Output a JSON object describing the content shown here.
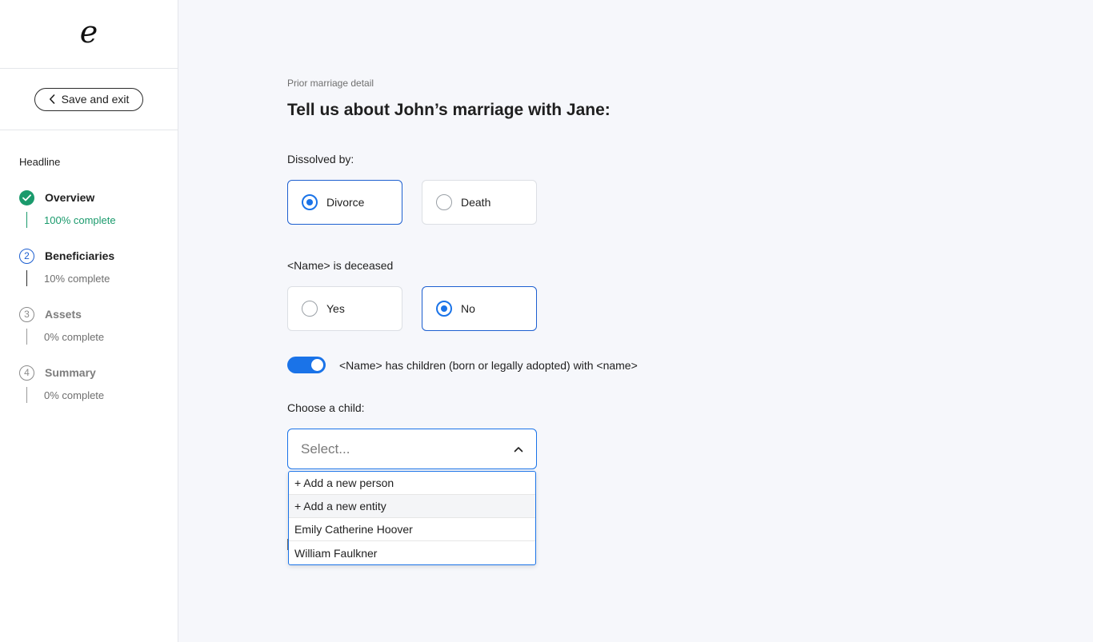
{
  "sidebar": {
    "logo_text": "e",
    "save_exit_label": "Save and exit",
    "nav_heading": "Headline",
    "steps": [
      {
        "number": "",
        "status": "done",
        "title": "Overview",
        "progress": "100% complete"
      },
      {
        "number": "2",
        "status": "active",
        "title": "Beneficiaries",
        "progress": "10% complete"
      },
      {
        "number": "3",
        "status": "idle",
        "title": "Assets",
        "progress": "0% complete"
      },
      {
        "number": "4",
        "status": "idle",
        "title": "Summary",
        "progress": "0% complete"
      }
    ]
  },
  "main": {
    "eyebrow": "Prior marriage detail",
    "heading": "Tell us about John’s marriage with Jane:",
    "dissolved": {
      "label": "Dissolved by:",
      "options": [
        {
          "label": "Divorce",
          "selected": true
        },
        {
          "label": "Death",
          "selected": false
        }
      ]
    },
    "deceased": {
      "label": "<Name> is deceased",
      "options": [
        {
          "label": "Yes",
          "selected": false
        },
        {
          "label": "No",
          "selected": true
        }
      ]
    },
    "children_toggle": {
      "on": true,
      "label": "<Name> has children (born or legally adopted) with <name>"
    },
    "child_select": {
      "label": "Choose a child:",
      "placeholder": "Select...",
      "open": true,
      "options": [
        "+ Add a new person",
        "+ Add a new entity",
        "Emily Catherine Hoover",
        "William Faulkner"
      ]
    }
  },
  "colors": {
    "accent_blue": "#1a73e8",
    "success_green": "#1a9a6c",
    "active_step_blue": "#1d5fd0"
  }
}
